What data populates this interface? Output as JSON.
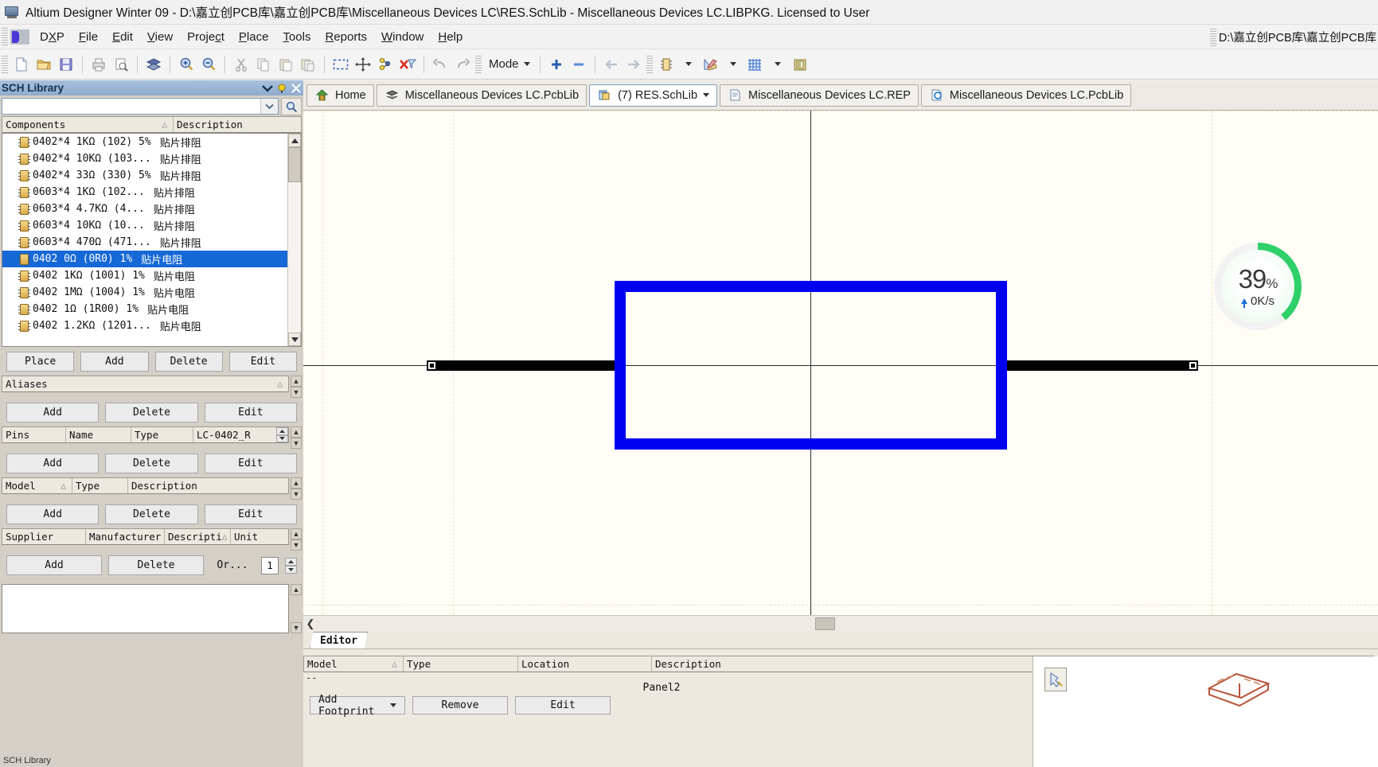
{
  "window": {
    "title": "Altium Designer Winter 09 - D:\\嘉立创PCB库\\嘉立创PCB库\\Miscellaneous Devices LC\\RES.SchLib - Miscellaneous Devices LC.LIBPKG. Licensed to User",
    "app_icon": "altium-icon"
  },
  "menubar": {
    "logo": "dxp-logo-icon",
    "items": [
      {
        "label": "DXP",
        "mnemonic": "X"
      },
      {
        "label": "File",
        "mnemonic": "F"
      },
      {
        "label": "Edit",
        "mnemonic": "E"
      },
      {
        "label": "View",
        "mnemonic": "V"
      },
      {
        "label": "Project",
        "mnemonic": "c"
      },
      {
        "label": "Place",
        "mnemonic": "P"
      },
      {
        "label": "Tools",
        "mnemonic": "T"
      },
      {
        "label": "Reports",
        "mnemonic": "R"
      },
      {
        "label": "Window",
        "mnemonic": "W"
      },
      {
        "label": "Help",
        "mnemonic": "H"
      }
    ],
    "right_path": "D:\\嘉立创PCB库\\嘉立创PCB库"
  },
  "toolbar": {
    "buttons": [
      "new-document-icon",
      "open-folder-icon",
      "save-icon",
      "print-icon",
      "print-preview-icon",
      "board-insight-icon",
      "zoom-in-icon",
      "zoom-out-icon",
      "cut-icon",
      "copy-icon",
      "paste-icon",
      "paste-special-icon",
      "select-area-icon",
      "move-icon",
      "clear-filter-icon",
      "clear-selection-icon",
      "undo-icon",
      "redo-icon"
    ],
    "mode_label": "Mode",
    "mode_caret": "chevron-down-icon",
    "plus_label": "+",
    "minus_label": "−",
    "nav_back": "arrow-left-icon",
    "nav_forward": "arrow-right-icon",
    "component_icon": "component-icon",
    "drawing_tools_icon": "drawing-tools-icon",
    "grid_icon": "grid-icon",
    "library_icon": "library-folder-icon"
  },
  "sch_library": {
    "caption": "SCH Library",
    "caption_icons": [
      "pin-panel-icon",
      "close-icon"
    ],
    "search": {
      "value": "",
      "placeholder": ""
    },
    "search_dropdown_icon": "chevron-down-icon",
    "search_button_icon": "magnifier-icon",
    "components_header": {
      "name": "Components",
      "sort": "△",
      "description": "Description"
    },
    "components": [
      {
        "name": "0402*4 1KΩ  (102) 5%",
        "description": "贴片排阻",
        "selected": false
      },
      {
        "name": "0402*4 10KΩ  (103...",
        "description": "贴片排阻",
        "selected": false
      },
      {
        "name": "0402*4 33Ω  (330) 5%",
        "description": "贴片排阻",
        "selected": false
      },
      {
        "name": "0603*4  1KΩ  (102...",
        "description": "贴片排阻",
        "selected": false
      },
      {
        "name": "0603*4  4.7KΩ  (4...",
        "description": "贴片排阻",
        "selected": false
      },
      {
        "name": "0603*4  10KΩ  (10...",
        "description": "贴片排阻",
        "selected": false
      },
      {
        "name": "0603*4 470Ω  (471...",
        "description": "贴片排阻",
        "selected": false
      },
      {
        "name": "0402 0Ω  (0R0) 1%",
        "description": "贴片电阻",
        "selected": true
      },
      {
        "name": "0402 1KΩ  (1001) 1%",
        "description": "贴片电阻",
        "selected": false
      },
      {
        "name": "0402 1MΩ  (1004) 1%",
        "description": "贴片电阻",
        "selected": false
      },
      {
        "name": "0402 1Ω  (1R00) 1%",
        "description": "贴片电阻",
        "selected": false
      },
      {
        "name": "0402 1.2KΩ  (1201...",
        "description": "贴片电阻",
        "selected": false
      }
    ],
    "components_buttons": [
      "Place",
      "Add",
      "Delete",
      "Edit"
    ],
    "aliases_header": {
      "name": "Aliases",
      "sort": "△"
    },
    "aliases_buttons": [
      "Add",
      "Delete",
      "Edit"
    ],
    "pins_header": {
      "pins": "Pins",
      "name": "Name",
      "type": "Type",
      "part": "LC-0402_R"
    },
    "pins_buttons": [
      "Add",
      "Delete",
      "Edit"
    ],
    "model_header": {
      "model": "Model",
      "sort": "△",
      "type": "Type",
      "description": "Description"
    },
    "model_buttons": [
      "Add",
      "Delete",
      "Edit"
    ],
    "supplier_header": {
      "supplier": "Supplier",
      "manufacturer": "Manufacturer",
      "description": "Descripti",
      "sort": "△",
      "unit": "Unit"
    },
    "supplier_buttons": [
      "Add",
      "Delete",
      "Or..."
    ],
    "supplier_order_qty": "1",
    "spinner_up_icon": "spinner-up-icon",
    "spinner_down_icon": "spinner-down-icon"
  },
  "doc_tabs": [
    {
      "label": "Home",
      "icon": "home-icon",
      "active": false,
      "has_caret": false
    },
    {
      "label": "Miscellaneous Devices LC.PcbLib",
      "icon": "pcblib-icon",
      "active": false,
      "has_caret": false
    },
    {
      "label": "(7) RES.SchLib",
      "icon": "schlib-icon",
      "active": true,
      "has_caret": true
    },
    {
      "label": "Miscellaneous Devices LC.REP",
      "icon": "report-icon",
      "active": false,
      "has_caret": false
    },
    {
      "label": "Miscellaneous Devices LC.PcbLib",
      "icon": "pcblib-ie-icon",
      "active": false,
      "has_caret": false
    }
  ],
  "canvas": {
    "symbol": "resistor-symbol",
    "symbol_color": "#0000f0",
    "lead_color": "#000000",
    "background": "#fffdf5",
    "grid_color": "#e6e0cf"
  },
  "download_widget": {
    "percent_label": "39",
    "percent_sign": "%",
    "percent_value": 39,
    "rate": "0K/s",
    "arrow_icon": "arrow-up-icon",
    "ring_color": "#2fd06a"
  },
  "hscroll": {
    "left_arrow": "chevron-left-icon"
  },
  "bottom_panel": {
    "tab": "Editor",
    "grid_header": {
      "model": "Model",
      "sort": "△",
      "type": "Type",
      "location": "Location",
      "description": "Description"
    },
    "dashes": "--",
    "panel_label": "Panel2",
    "buttons": [
      {
        "label": "Add Footprint",
        "caret": "chevron-down-icon"
      },
      {
        "label": "Remove",
        "caret": ""
      },
      {
        "label": "Edit",
        "caret": ""
      }
    ],
    "preview_icon": "footprint-preview-icon",
    "footprint_3d_icon": "footprint-3d-icon"
  }
}
